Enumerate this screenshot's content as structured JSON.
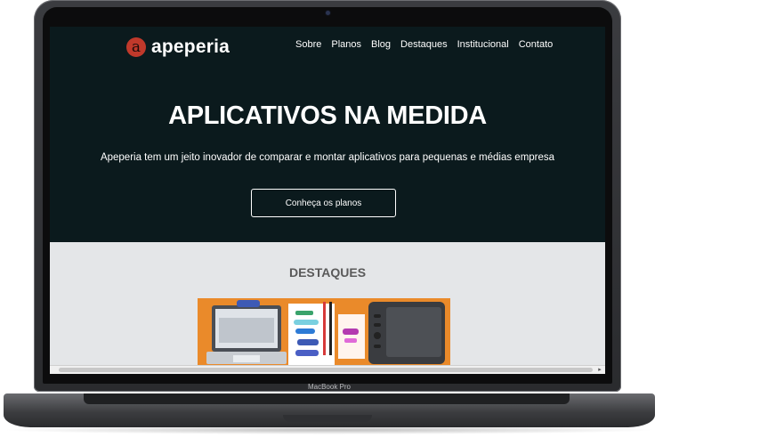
{
  "device": {
    "label": "MacBook Pro"
  },
  "site": {
    "logo": {
      "mark": "a",
      "text": "apeperia",
      "mark_color": "#c0392b"
    },
    "nav": [
      {
        "label": "Sobre"
      },
      {
        "label": "Planos"
      },
      {
        "label": "Blog"
      },
      {
        "label": "Destaques"
      },
      {
        "label": "Institucional"
      },
      {
        "label": "Contato"
      }
    ],
    "hero": {
      "title": "APLICATIVOS NA MEDIDA",
      "subtitle": "Apeperia tem um jeito inovador de comparar e montar aplicativos para pequenas e médias empresa",
      "cta_label": "Conheça os planos",
      "background": "#0b1a1d"
    },
    "featured": {
      "title": "DESTAQUES",
      "image_icon": "workspace-illustration-icon",
      "accent": "#ea8a2a"
    }
  }
}
